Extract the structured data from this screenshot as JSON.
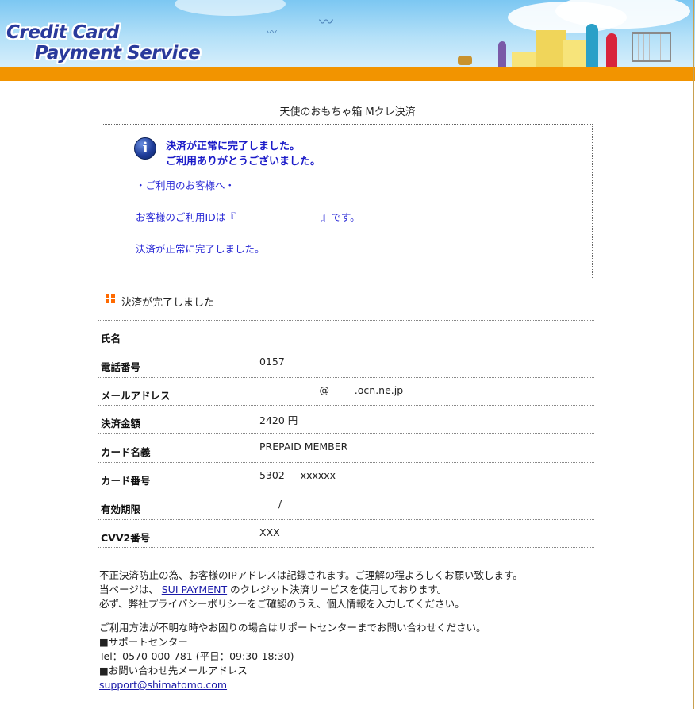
{
  "header": {
    "logo_line1": "Credit Card",
    "logo_line2": "Payment Service",
    "band_color": "#f29400"
  },
  "shop_title": "天使のおもちゃ箱 Mクレ決済",
  "notice": {
    "icon": "info-icon",
    "main_line1": "決済が正常に完了しました。",
    "main_line2": "ご利用ありがとうございました。",
    "greeting": "・ご利用のお客様へ・",
    "id_prefix": "お客様のご利用IDは『",
    "id_suffix": "』です。",
    "completed": "決済が正常に完了しました。"
  },
  "section_title": "決済が完了しました",
  "rows": [
    {
      "label": "氏名",
      "value": ""
    },
    {
      "label": "電話番号",
      "value": "0157"
    },
    {
      "label": "メールアドレス",
      "value": "                   @        .ocn.ne.jp"
    },
    {
      "label": "決済金額",
      "value": "2420 円"
    },
    {
      "label": "カード名義",
      "value": "PREPAID MEMBER"
    },
    {
      "label": "カード番号",
      "value": "5302     xxxxxx"
    },
    {
      "label": "有効期限",
      "value": "      /"
    },
    {
      "label": "CVV2番号",
      "value": "XXX"
    }
  ],
  "footer": {
    "line1": "不正決済防止の為、お客様のIPアドレスは記録されます。ご理解の程よろしくお願い致します。",
    "line2_prefix": "当ページは、 ",
    "line2_link": "SUI PAYMENT",
    "line2_suffix": " のクレジット決済サービスを使用しております。",
    "line3": "必ず、弊社プライバシーポリシーをご確認のうえ、個人情報を入力してください。",
    "line4": "ご利用方法が不明な時やお困りの場合はサポートセンターまでお問い合わせください。",
    "line5": "■サポートセンター",
    "line6": "Tel：0570-000-781 (平日：09:30-18:30)",
    "line7": "■お問い合わせ先メールアドレス",
    "email": "support@shimatomo.com"
  }
}
